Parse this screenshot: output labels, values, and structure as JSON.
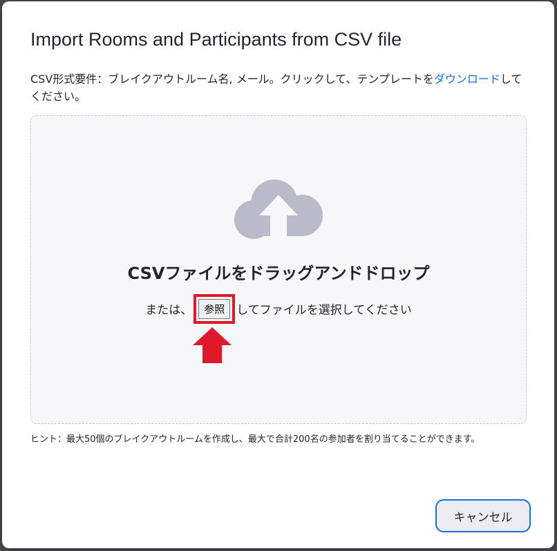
{
  "dialog": {
    "title": "Import Rooms and Participants from CSV file",
    "requirements_text": "CSV形式要件：ブレイクアウトルーム名, メール。クリックして、テンプレートを",
    "download_link": "ダウンロード",
    "requirements_suffix": "してください。",
    "hint": "ヒント：最大50個のブレイクアウトルームを作成し、最大で合計200名の参加者を割り当てることができます。",
    "cancel_label": "キャンセル"
  },
  "dropzone": {
    "title": "CSVファイルをドラッグアンドドロップ",
    "sub_prefix": "または、",
    "browse_label": "参照",
    "sub_suffix": "してファイルを選択してください",
    "icon": "cloud-upload-icon"
  },
  "colors": {
    "accent": "#0e72ed",
    "highlight": "#e0182a",
    "cloud": "#babacb"
  }
}
